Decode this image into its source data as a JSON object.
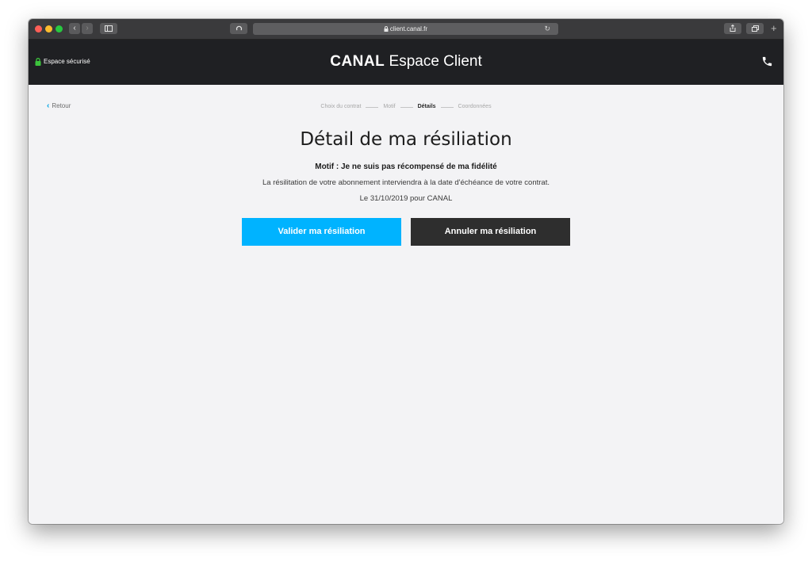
{
  "browser": {
    "url": "client.canal.fr"
  },
  "header": {
    "secure_label": "Espace sécurisé",
    "logo_brand": "CANAL",
    "logo_rest": "Espace Client"
  },
  "nav": {
    "back_label": "Retour"
  },
  "steps": [
    {
      "label": "Choix du contrat"
    },
    {
      "label": "Motif"
    },
    {
      "label": "Détails",
      "active": true
    },
    {
      "label": "Coordonnées"
    }
  ],
  "main": {
    "title": "Détail de ma résiliation",
    "motif": "Motif : Je ne suis pas récompensé de ma fidélité",
    "info_line": "La résilitation de votre abonnement interviendra à la date d'échéance de votre contrat.",
    "date_line": "Le 31/10/2019 pour CANAL",
    "validate_label": "Valider ma résiliation",
    "cancel_label": "Annuler ma résiliation"
  },
  "colors": {
    "primary": "#00b3ff",
    "secondary": "#2e2e2e",
    "header_bg": "#1f2023",
    "accent": "#00a4e4",
    "secure_green": "#3cc43c"
  }
}
